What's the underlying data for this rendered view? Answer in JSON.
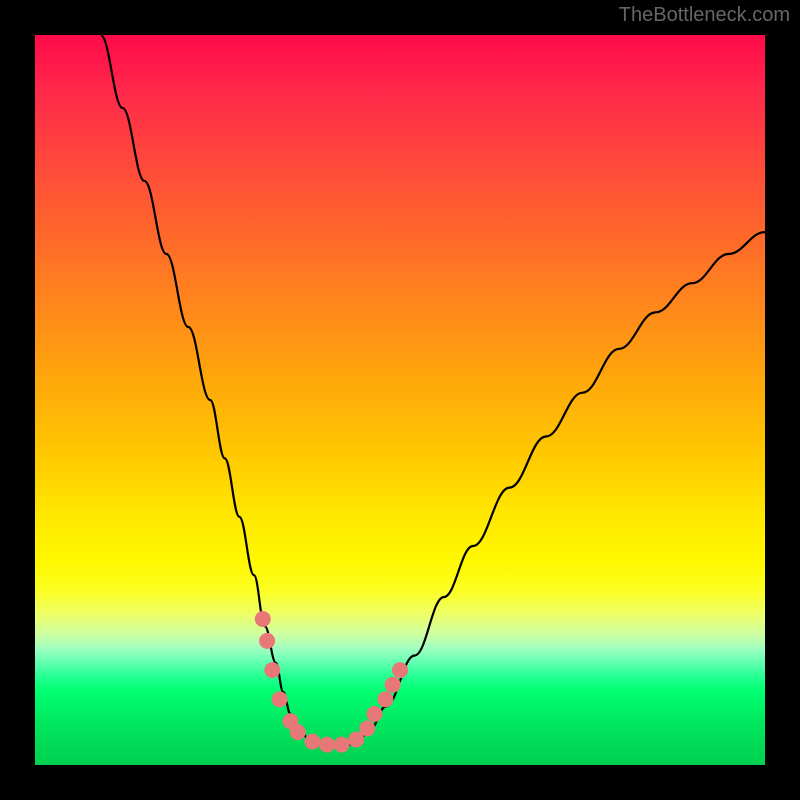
{
  "watermark": "TheBottleneck.com",
  "chart_data": {
    "type": "line",
    "title": "",
    "xlabel": "",
    "ylabel": "",
    "xlim": [
      0,
      100
    ],
    "ylim": [
      0,
      100
    ],
    "series": [
      {
        "name": "curve",
        "x": [
          9,
          12,
          15,
          18,
          21,
          24,
          26,
          28,
          30,
          31.5,
          33,
          34,
          35,
          36,
          38,
          40,
          42,
          44,
          46,
          48,
          52,
          56,
          60,
          65,
          70,
          75,
          80,
          85,
          90,
          95,
          100
        ],
        "y": [
          100,
          90,
          80,
          70,
          60,
          50,
          42,
          34,
          26,
          19,
          14,
          10,
          7,
          5,
          3,
          2.5,
          2.5,
          3,
          5,
          8,
          15,
          23,
          30,
          38,
          45,
          51,
          57,
          62,
          66,
          70,
          73
        ]
      }
    ],
    "markers": {
      "name": "highlight-dots",
      "color": "#e87878",
      "points": [
        {
          "x": 31.2,
          "y": 20
        },
        {
          "x": 31.8,
          "y": 17
        },
        {
          "x": 32.5,
          "y": 13
        },
        {
          "x": 33.5,
          "y": 9
        },
        {
          "x": 35,
          "y": 6
        },
        {
          "x": 36,
          "y": 4.5
        },
        {
          "x": 38,
          "y": 3.2
        },
        {
          "x": 40,
          "y": 2.8
        },
        {
          "x": 42,
          "y": 2.8
        },
        {
          "x": 44,
          "y": 3.5
        },
        {
          "x": 45.5,
          "y": 5
        },
        {
          "x": 46.5,
          "y": 7
        },
        {
          "x": 48,
          "y": 9
        },
        {
          "x": 49,
          "y": 11
        },
        {
          "x": 50,
          "y": 13
        }
      ]
    }
  }
}
